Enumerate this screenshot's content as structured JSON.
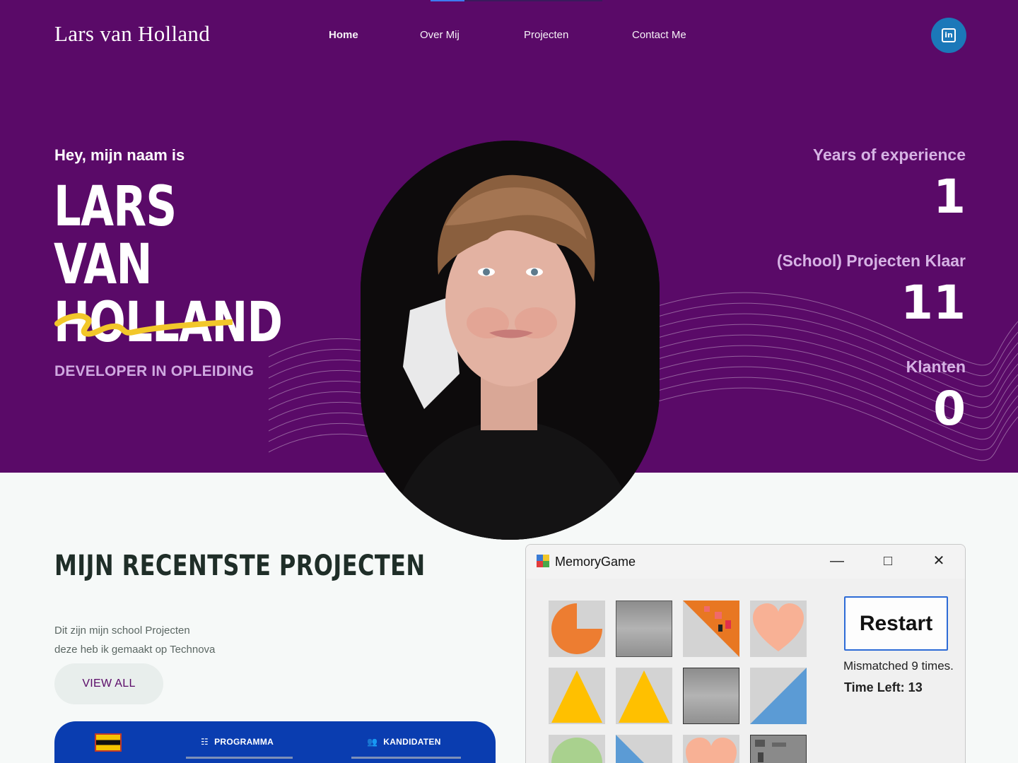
{
  "header": {
    "logo": "Lars van Holland",
    "nav": [
      {
        "label": "Home",
        "active": true
      },
      {
        "label": "Over Mij",
        "active": false
      },
      {
        "label": "Projecten",
        "active": false
      },
      {
        "label": "Contact Me",
        "active": false
      }
    ],
    "social_icon": "linkedin-icon",
    "social_glyph": "in"
  },
  "hero": {
    "greeting": "Hey, mijn naam is",
    "name_line1": "Lars van",
    "name_line2": "Holland",
    "role": "Developer in opleiding",
    "stats": [
      {
        "label": "Years of experience",
        "value": "1"
      },
      {
        "label": "(School) Projecten Klaar",
        "value": "11"
      },
      {
        "label": "Klanten",
        "value": "0"
      }
    ]
  },
  "projects": {
    "title": "Mijn recentste projecten",
    "description_line1": "Dit zijn mijn school Projecten",
    "description_line2": "deze heb ik gemaakt op Technova",
    "view_all": "View All",
    "card_tabs": [
      {
        "label": "PROGRAMMA",
        "icon": "list-icon"
      },
      {
        "label": "KANDIDATEN",
        "icon": "users-icon"
      }
    ]
  },
  "memory_game": {
    "window_title": "MemoryGame",
    "restart_label": "Restart",
    "mismatch_text": "Mismatched 9 times.",
    "time_left_text": "Time Left: 13"
  },
  "colors": {
    "hero_bg": "#5a0a68",
    "accent_yellow": "#f2c72a",
    "card_blue": "#0a3db0",
    "linkedin_blue": "#1b78b9"
  }
}
